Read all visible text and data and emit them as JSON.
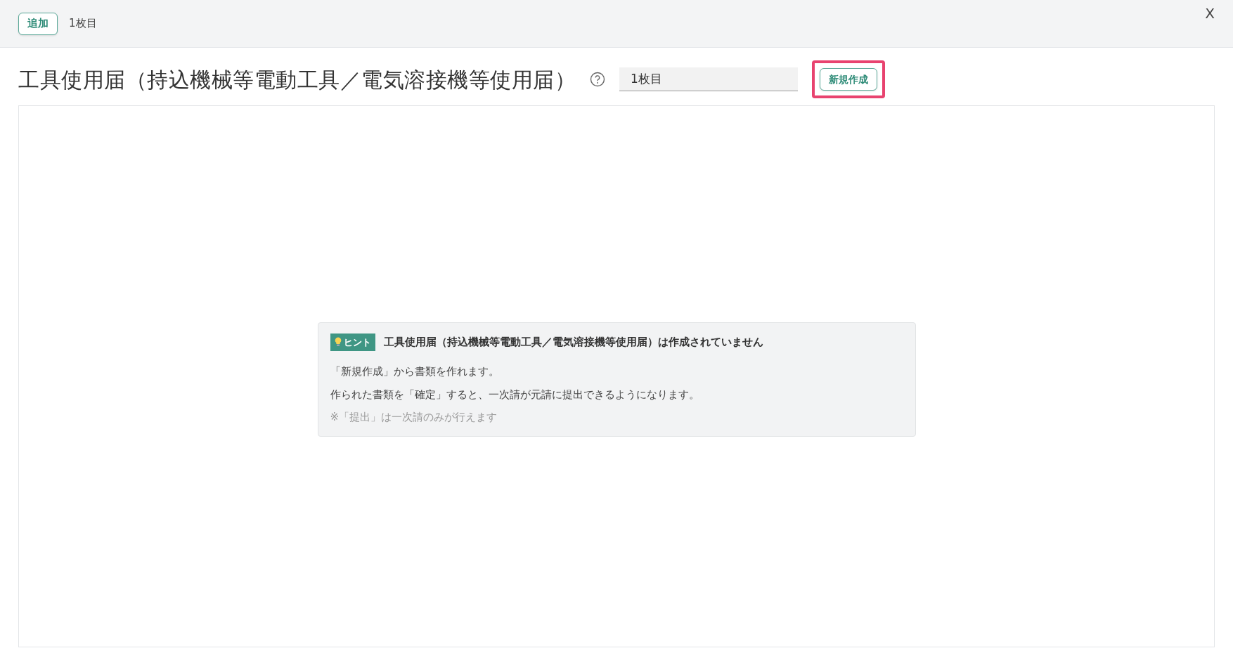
{
  "top_bar": {
    "add_button": "追加",
    "sheet_label": "1枚目",
    "close": "X"
  },
  "header": {
    "title": "工具使用届（持込機械等電動工具／電気溶接機等使用届）",
    "sheet_select": "1枚目",
    "new_button": "新規作成",
    "highlighted": true
  },
  "hint": {
    "badge": "ヒント",
    "title": "工具使用届（持込機械等電動工具／電気溶接機等使用届）は作成されていません",
    "lines": [
      "「新規作成」から書類を作れます。",
      "作られた書類を「確定」すると、一次請が元請に提出できるようになります。"
    ],
    "note": "※「提出」は一次請のみが行えます"
  }
}
